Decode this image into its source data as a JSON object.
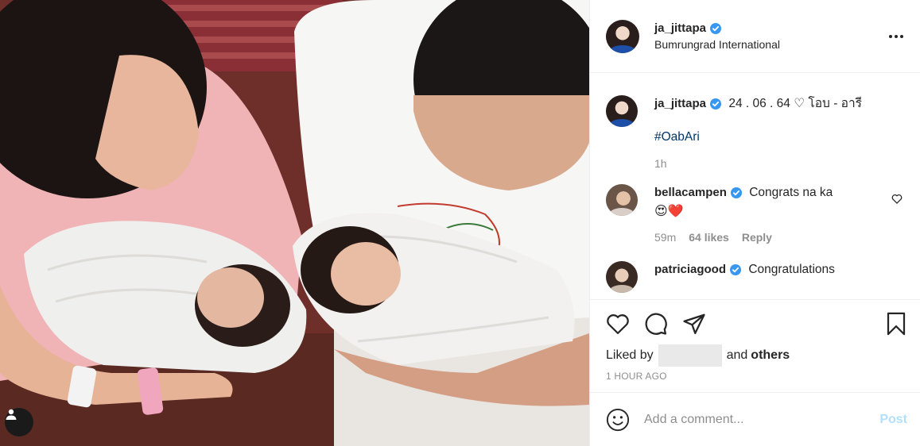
{
  "post": {
    "username": "ja_jittapa",
    "location": "Bumrungrad International",
    "caption_text": "24 . 06 . 64 ♡ โอบ - อารี",
    "hashtag": "#OabAri",
    "caption_time": "1h",
    "liked_by_label": "Liked by",
    "liked_by_and": "and",
    "liked_by_others": "others",
    "posted_ago": "1 HOUR AGO"
  },
  "comments": [
    {
      "username": "bellacampen",
      "text": "Congrats na ka",
      "emoji": "😍❤️",
      "time": "59m",
      "likes": "64 likes",
      "reply": "Reply"
    },
    {
      "username": "patriciagood",
      "text": "Congratulations"
    }
  ],
  "add_comment": {
    "placeholder": "Add a comment...",
    "post_label": "Post"
  },
  "icons": {
    "more": "more-options-icon",
    "like": "heart-icon",
    "comment": "comment-icon",
    "share": "share-icon",
    "save": "bookmark-icon",
    "emoji": "emoji-icon",
    "tags": "user-tag-icon"
  },
  "colors": {
    "verified": "#3897f0",
    "link": "#00376b",
    "muted": "#8e8e8e",
    "post_button": "#b2dffc"
  }
}
